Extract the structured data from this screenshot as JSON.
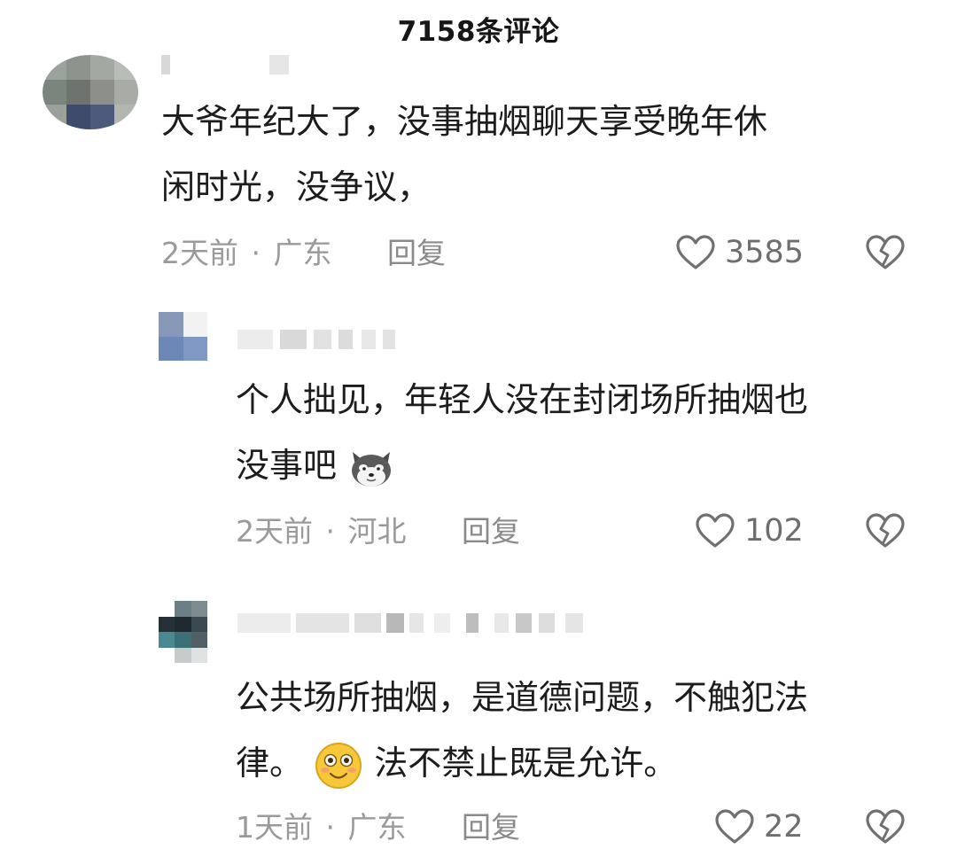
{
  "header": {
    "title": "7158条评论"
  },
  "comments": [
    {
      "lines": [
        "大爷年纪大了，没事抽烟聊天享受晚年休",
        "闲时光，没争议，"
      ],
      "time": "2天前",
      "separator": "·",
      "location": "广东",
      "reply_label": "回复",
      "likes": "3585"
    },
    {
      "lines": [
        "个人拙见，年轻人没在封闭场所抽烟也",
        "没事吧"
      ],
      "emoji": "dog-emoji",
      "time": "2天前",
      "separator": "·",
      "location": "河北",
      "reply_label": "回复",
      "likes": "102"
    },
    {
      "lines": [
        "公共场所抽烟，是道德问题，不触犯法",
        "律。",
        "法不禁止既是允许。"
      ],
      "emoji": "smile-emoji",
      "time": "1天前",
      "separator": "·",
      "location": "广东",
      "reply_label": "回复",
      "likes": "22"
    }
  ],
  "icons": {
    "like": "heart-outline-icon",
    "dislike": "broken-heart-icon"
  },
  "colors": {
    "meta": "#9a9a9a",
    "text": "#1c1c1c",
    "icon": "#707070"
  }
}
